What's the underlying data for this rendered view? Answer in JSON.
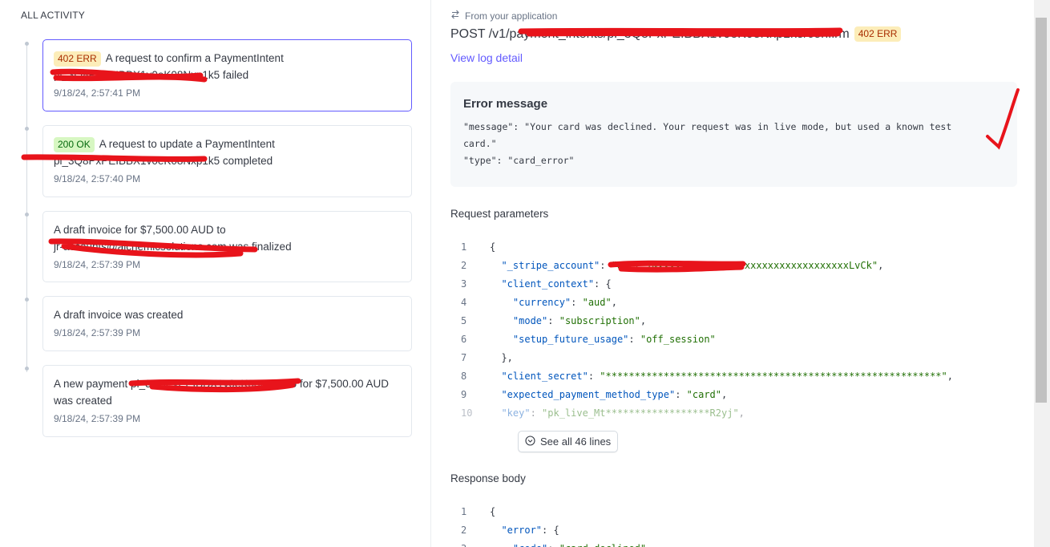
{
  "activity": {
    "title": "ALL ACTIVITY",
    "items": [
      {
        "badge": "402 ERR",
        "badge_kind": "err",
        "text": "A request to confirm a PaymentIntent",
        "text2": "pi_3Q8PxPEIBBX1v0eK08Nxp1k5 failed",
        "time": "9/18/24, 2:57:41 PM",
        "selected": true
      },
      {
        "badge": "200 OK",
        "badge_kind": "ok",
        "text": "A request to update a PaymentIntent",
        "text2": "pi_3Q8PxPEIBBX1v0eK08Nxp1k5 completed",
        "time": "9/18/24, 2:57:40 PM"
      },
      {
        "text": "A draft invoice for $7,500.00 AUD to",
        "text2": "jr-accounts@alchemicsolutions.com was finalized",
        "time": "9/18/24, 2:57:39 PM"
      },
      {
        "text": "A draft invoice was created",
        "time": "9/18/24, 2:57:39 PM"
      },
      {
        "text": "A new payment pi_3Q8PxPEIBBX1v0eK08Nxp1k5 for $7,500.00 AUD",
        "text2": "was created",
        "time": "9/18/24, 2:57:39 PM"
      }
    ]
  },
  "detail": {
    "source": "From your application",
    "request": "POST /v1/payment_intents/pi_3Q8PxPEIBBX1v0eK08Nxp1k5/confirm",
    "status_badge": "402 ERR",
    "view_log": "View log detail",
    "error": {
      "title": "Error message",
      "line1": "\"message\": \"Your card was declined. Your request was in live mode, but used a known test",
      "line2": "card.\"",
      "line3": "\"type\": \"card_error\""
    },
    "request_params_title": "Request parameters",
    "see_all": "See all 46 lines",
    "response_title": "Response body"
  },
  "colors": {
    "accent": "#635bff",
    "err_bg": "#fcedb9",
    "err_fg": "#a82c00",
    "ok_bg": "#d7f7c2",
    "ok_fg": "#05690d",
    "annotation_red": "#e8141b"
  },
  "icons": {
    "source": "arrows-swap-icon",
    "see_all": "chevron-down-circle-icon"
  }
}
